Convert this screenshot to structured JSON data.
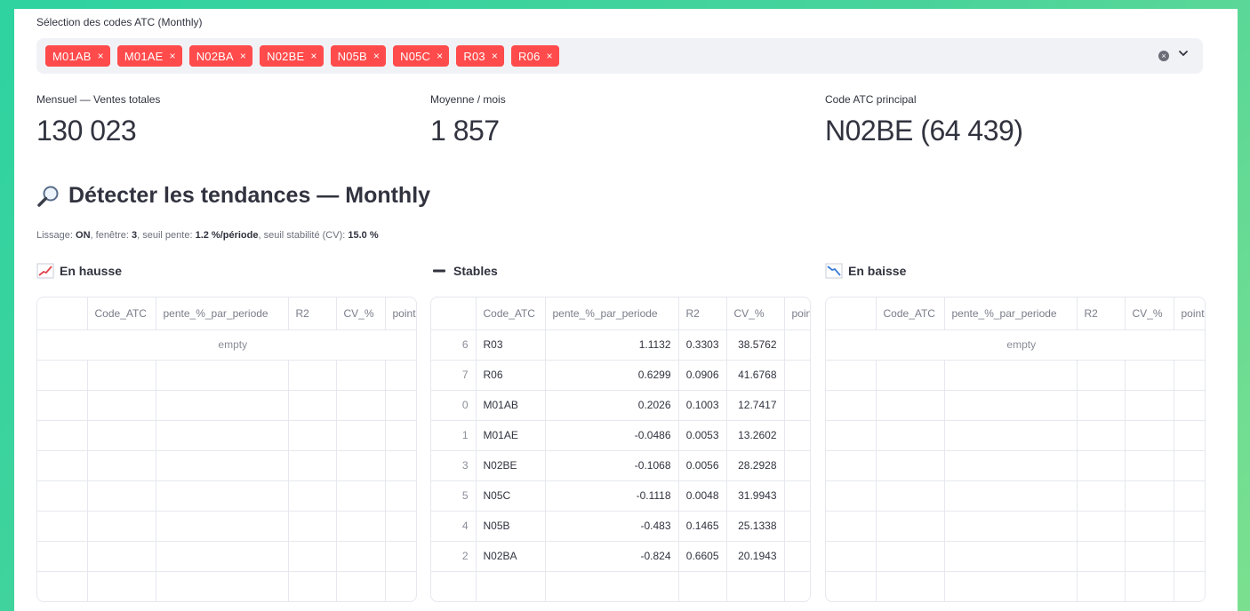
{
  "multiselect": {
    "label": "Sélection des codes ATC (Monthly)",
    "tags": [
      "M01AB",
      "M01AE",
      "N02BA",
      "N02BE",
      "N05B",
      "N05C",
      "R03",
      "R06"
    ],
    "tag_close": "×",
    "clear_icon": "×"
  },
  "metrics": [
    {
      "label": "Mensuel — Ventes totales",
      "value": "130 023"
    },
    {
      "label": "Moyenne / mois",
      "value": "1 857"
    },
    {
      "label": "Code ATC principal",
      "value": "N02BE (64 439)"
    }
  ],
  "heading": {
    "icon": "magnifier-icon",
    "title": "Détecter les tendances — Monthly"
  },
  "caption": {
    "p1": "Lissage: ",
    "b1": "ON",
    "p2": ", fenêtre: ",
    "b2": "3",
    "p3": ", seuil pente: ",
    "b3": "1.2 %/période",
    "p4": ", seuil stabilité (CV): ",
    "b4": "15.0 %"
  },
  "sections": {
    "up": {
      "icon": "chart-increasing-icon",
      "title": "En hausse",
      "empty": "empty"
    },
    "stable": {
      "icon": "minus-icon",
      "title": "Stables"
    },
    "down": {
      "icon": "chart-decreasing-icon",
      "title": "En baisse",
      "empty": "empty"
    }
  },
  "columns": [
    "",
    "Code_ATC",
    "pente_%_par_periode",
    "R2",
    "CV_%",
    "point"
  ],
  "stable_rows": [
    {
      "idx": "6",
      "code": "R03",
      "pente": "1.1132",
      "r2": "0.3303",
      "cv": "38.5762"
    },
    {
      "idx": "7",
      "code": "R06",
      "pente": "0.6299",
      "r2": "0.0906",
      "cv": "41.6768"
    },
    {
      "idx": "0",
      "code": "M01AB",
      "pente": "0.2026",
      "r2": "0.1003",
      "cv": "12.7417"
    },
    {
      "idx": "1",
      "code": "M01AE",
      "pente": "-0.0486",
      "r2": "0.0053",
      "cv": "13.2602"
    },
    {
      "idx": "3",
      "code": "N02BE",
      "pente": "-0.1068",
      "r2": "0.0056",
      "cv": "28.2928"
    },
    {
      "idx": "5",
      "code": "N05C",
      "pente": "-0.1118",
      "r2": "0.0048",
      "cv": "31.9943"
    },
    {
      "idx": "4",
      "code": "N05B",
      "pente": "-0.483",
      "r2": "0.1465",
      "cv": "25.1338"
    },
    {
      "idx": "2",
      "code": "N02BA",
      "pente": "-0.824",
      "r2": "0.6605",
      "cv": "20.1943"
    }
  ],
  "colors": {
    "tag": "#ff4b4b",
    "box": "#f0f2f6",
    "text": "#31333f"
  }
}
